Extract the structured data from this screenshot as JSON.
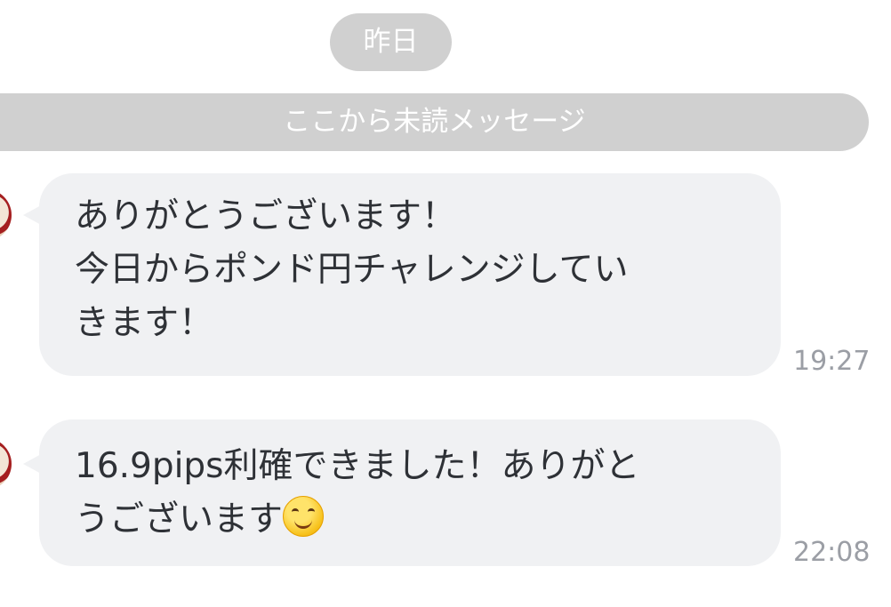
{
  "date_divider": {
    "label": "昨日"
  },
  "unread_divider": {
    "label": "ここから未読メッセージ"
  },
  "messages": [
    {
      "lines": [
        "ありがとうございます！",
        "今日からポンド円チャレンジしてい",
        "きます！"
      ],
      "time": "19:27"
    },
    {
      "lines": [
        "16.9pips利確できました！ありがと",
        "うございます"
      ],
      "emoji": "smiling-face-emoji",
      "time": "22:08"
    }
  ],
  "colors": {
    "divider_bg": "#d0d0d0",
    "divider_text": "#ffffff",
    "bubble_bg": "#f0f1f3",
    "message_text": "#2e3136",
    "time_text": "#9b9ea5"
  }
}
